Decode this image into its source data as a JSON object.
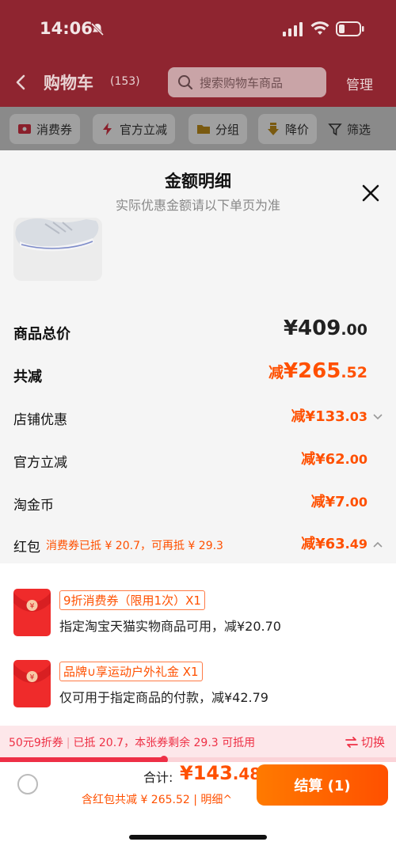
{
  "status_bar": {
    "time": "14:06"
  },
  "nav": {
    "title": "购物车",
    "count": "(153)",
    "search_placeholder": "搜索购物车商品",
    "manage": "管理"
  },
  "filters": [
    {
      "label": "消费券"
    },
    {
      "label": "官方立减"
    },
    {
      "label": "分组"
    },
    {
      "label": "降价"
    },
    {
      "label": "筛选"
    }
  ],
  "sheet": {
    "title": "金额明细",
    "subtitle": "实际优惠金额请以下单页为准",
    "rows": {
      "total": {
        "label": "商品总价",
        "currency": "¥",
        "main": "409",
        "cents": ".00"
      },
      "reduce": {
        "label": "共减",
        "prefix": "减",
        "currency": "¥",
        "main": "265",
        "cents": ".52"
      },
      "shop": {
        "label": "店铺优惠",
        "value_main": "减¥133",
        "value_cents": ".03"
      },
      "official": {
        "label": "官方立减",
        "value_main": "减¥62",
        "value_cents": ".00"
      },
      "coins": {
        "label": "淘金币",
        "value_main": "减¥7",
        "value_cents": ".00"
      },
      "redpacket": {
        "label": "红包",
        "note": "消费券已抵 ¥ 20.7，可再抵 ¥ 29.3",
        "value_main": "减¥63",
        "value_cents": ".49"
      }
    },
    "coupons": [
      {
        "tag": "9折消费券（限用1次）X1",
        "desc": "指定淘宝天猫实物商品可用，减¥20.70"
      },
      {
        "tag": "品牌∪享运动户外礼金 X1",
        "desc": "仅可用于指定商品的付款，减¥42.79"
      }
    ],
    "promo": {
      "name": "50元9折券",
      "detail": "已抵 20.7，本张券剩余 29.3 可抵用",
      "switch": "切换",
      "used_fraction": 0.414
    }
  },
  "footer": {
    "sum_label": "合计:",
    "sum_main": "¥143",
    "sum_cents": ".48",
    "sum_note": "含红包共减 ¥ 265.52 | 明细^",
    "checkout": "结算 (1)"
  },
  "colors": {
    "accent": "#ff5000",
    "promo_red": "#ee3045",
    "header_bg": "#8f2530"
  }
}
